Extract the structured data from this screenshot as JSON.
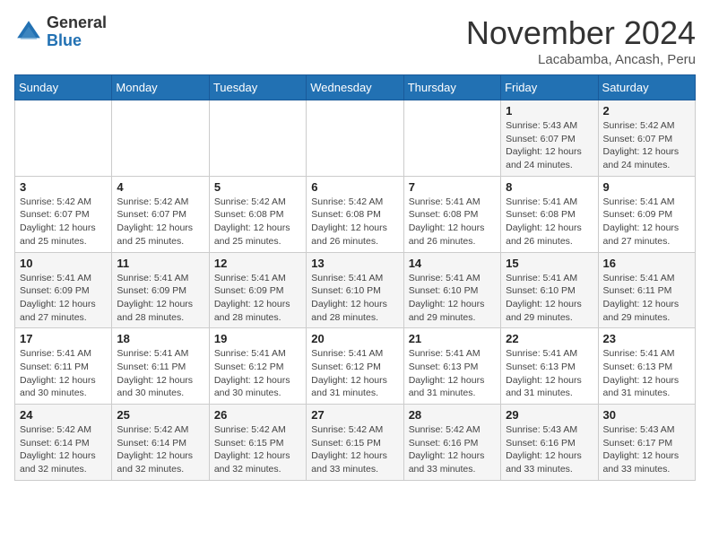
{
  "header": {
    "logo": {
      "general": "General",
      "blue": "Blue"
    },
    "title": "November 2024",
    "subtitle": "Lacabamba, Ancash, Peru"
  },
  "calendar": {
    "weekdays": [
      "Sunday",
      "Monday",
      "Tuesday",
      "Wednesday",
      "Thursday",
      "Friday",
      "Saturday"
    ],
    "weeks": [
      [
        {
          "day": "",
          "info": ""
        },
        {
          "day": "",
          "info": ""
        },
        {
          "day": "",
          "info": ""
        },
        {
          "day": "",
          "info": ""
        },
        {
          "day": "",
          "info": ""
        },
        {
          "day": "1",
          "info": "Sunrise: 5:43 AM\nSunset: 6:07 PM\nDaylight: 12 hours\nand 24 minutes."
        },
        {
          "day": "2",
          "info": "Sunrise: 5:42 AM\nSunset: 6:07 PM\nDaylight: 12 hours\nand 24 minutes."
        }
      ],
      [
        {
          "day": "3",
          "info": "Sunrise: 5:42 AM\nSunset: 6:07 PM\nDaylight: 12 hours\nand 25 minutes."
        },
        {
          "day": "4",
          "info": "Sunrise: 5:42 AM\nSunset: 6:07 PM\nDaylight: 12 hours\nand 25 minutes."
        },
        {
          "day": "5",
          "info": "Sunrise: 5:42 AM\nSunset: 6:08 PM\nDaylight: 12 hours\nand 25 minutes."
        },
        {
          "day": "6",
          "info": "Sunrise: 5:42 AM\nSunset: 6:08 PM\nDaylight: 12 hours\nand 26 minutes."
        },
        {
          "day": "7",
          "info": "Sunrise: 5:41 AM\nSunset: 6:08 PM\nDaylight: 12 hours\nand 26 minutes."
        },
        {
          "day": "8",
          "info": "Sunrise: 5:41 AM\nSunset: 6:08 PM\nDaylight: 12 hours\nand 26 minutes."
        },
        {
          "day": "9",
          "info": "Sunrise: 5:41 AM\nSunset: 6:09 PM\nDaylight: 12 hours\nand 27 minutes."
        }
      ],
      [
        {
          "day": "10",
          "info": "Sunrise: 5:41 AM\nSunset: 6:09 PM\nDaylight: 12 hours\nand 27 minutes."
        },
        {
          "day": "11",
          "info": "Sunrise: 5:41 AM\nSunset: 6:09 PM\nDaylight: 12 hours\nand 28 minutes."
        },
        {
          "day": "12",
          "info": "Sunrise: 5:41 AM\nSunset: 6:09 PM\nDaylight: 12 hours\nand 28 minutes."
        },
        {
          "day": "13",
          "info": "Sunrise: 5:41 AM\nSunset: 6:10 PM\nDaylight: 12 hours\nand 28 minutes."
        },
        {
          "day": "14",
          "info": "Sunrise: 5:41 AM\nSunset: 6:10 PM\nDaylight: 12 hours\nand 29 minutes."
        },
        {
          "day": "15",
          "info": "Sunrise: 5:41 AM\nSunset: 6:10 PM\nDaylight: 12 hours\nand 29 minutes."
        },
        {
          "day": "16",
          "info": "Sunrise: 5:41 AM\nSunset: 6:11 PM\nDaylight: 12 hours\nand 29 minutes."
        }
      ],
      [
        {
          "day": "17",
          "info": "Sunrise: 5:41 AM\nSunset: 6:11 PM\nDaylight: 12 hours\nand 30 minutes."
        },
        {
          "day": "18",
          "info": "Sunrise: 5:41 AM\nSunset: 6:11 PM\nDaylight: 12 hours\nand 30 minutes."
        },
        {
          "day": "19",
          "info": "Sunrise: 5:41 AM\nSunset: 6:12 PM\nDaylight: 12 hours\nand 30 minutes."
        },
        {
          "day": "20",
          "info": "Sunrise: 5:41 AM\nSunset: 6:12 PM\nDaylight: 12 hours\nand 31 minutes."
        },
        {
          "day": "21",
          "info": "Sunrise: 5:41 AM\nSunset: 6:13 PM\nDaylight: 12 hours\nand 31 minutes."
        },
        {
          "day": "22",
          "info": "Sunrise: 5:41 AM\nSunset: 6:13 PM\nDaylight: 12 hours\nand 31 minutes."
        },
        {
          "day": "23",
          "info": "Sunrise: 5:41 AM\nSunset: 6:13 PM\nDaylight: 12 hours\nand 31 minutes."
        }
      ],
      [
        {
          "day": "24",
          "info": "Sunrise: 5:42 AM\nSunset: 6:14 PM\nDaylight: 12 hours\nand 32 minutes."
        },
        {
          "day": "25",
          "info": "Sunrise: 5:42 AM\nSunset: 6:14 PM\nDaylight: 12 hours\nand 32 minutes."
        },
        {
          "day": "26",
          "info": "Sunrise: 5:42 AM\nSunset: 6:15 PM\nDaylight: 12 hours\nand 32 minutes."
        },
        {
          "day": "27",
          "info": "Sunrise: 5:42 AM\nSunset: 6:15 PM\nDaylight: 12 hours\nand 33 minutes."
        },
        {
          "day": "28",
          "info": "Sunrise: 5:42 AM\nSunset: 6:16 PM\nDaylight: 12 hours\nand 33 minutes."
        },
        {
          "day": "29",
          "info": "Sunrise: 5:43 AM\nSunset: 6:16 PM\nDaylight: 12 hours\nand 33 minutes."
        },
        {
          "day": "30",
          "info": "Sunrise: 5:43 AM\nSunset: 6:17 PM\nDaylight: 12 hours\nand 33 minutes."
        }
      ]
    ]
  }
}
